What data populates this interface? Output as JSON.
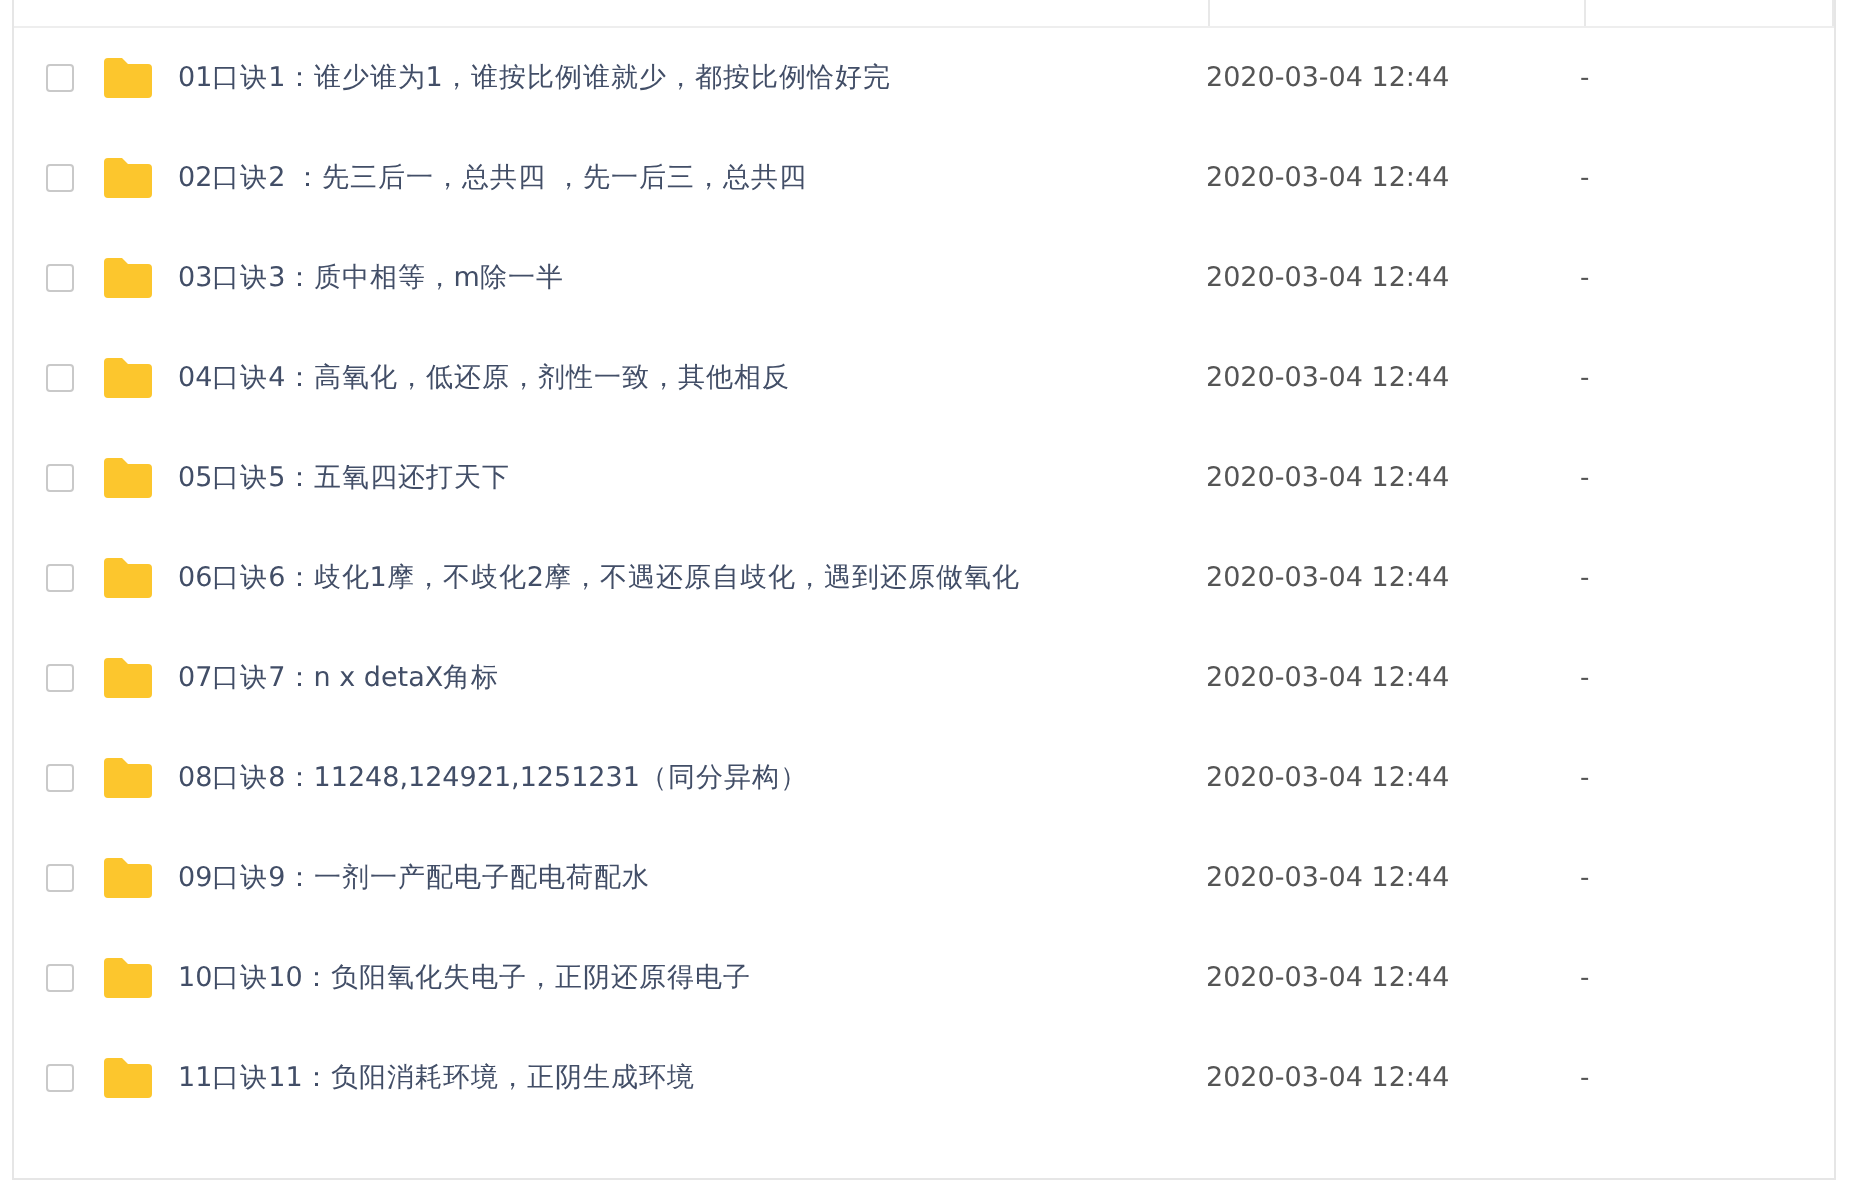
{
  "table": {
    "rows": [
      {
        "name": "01口诀1：谁少谁为1，谁按比例谁就少，都按比例恰好完",
        "modified": "2020-03-04 12:44",
        "size": "-",
        "checked": false
      },
      {
        "name": "02口诀2 ：先三后一，总共四 ，先一后三，总共四",
        "modified": "2020-03-04 12:44",
        "size": "-",
        "checked": false
      },
      {
        "name": "03口诀3：质中相等，m除一半",
        "modified": "2020-03-04 12:44",
        "size": "-",
        "checked": false
      },
      {
        "name": "04口诀4：高氧化，低还原，剂性一致，其他相反",
        "modified": "2020-03-04 12:44",
        "size": "-",
        "checked": false
      },
      {
        "name": "05口诀5：五氧四还打天下",
        "modified": "2020-03-04 12:44",
        "size": "-",
        "checked": false
      },
      {
        "name": "06口诀6：歧化1摩，不歧化2摩，不遇还原自歧化，遇到还原做氧化",
        "modified": "2020-03-04 12:44",
        "size": "-",
        "checked": false
      },
      {
        "name": "07口诀7：n x detaX角标",
        "modified": "2020-03-04 12:44",
        "size": "-",
        "checked": false
      },
      {
        "name": "08口诀8：11248,124921,1251231（同分异构）",
        "modified": "2020-03-04 12:44",
        "size": "-",
        "checked": false
      },
      {
        "name": "09口诀9：一剂一产配电子配电荷配水",
        "modified": "2020-03-04 12:44",
        "size": "-",
        "checked": false
      },
      {
        "name": "10口诀10：负阳氧化失电子，正阴还原得电子",
        "modified": "2020-03-04 12:44",
        "size": "-",
        "checked": false
      },
      {
        "name": "11口诀11：负阳消耗环境，正阴生成环境",
        "modified": "2020-03-04 12:44",
        "size": "-",
        "checked": false
      }
    ]
  }
}
